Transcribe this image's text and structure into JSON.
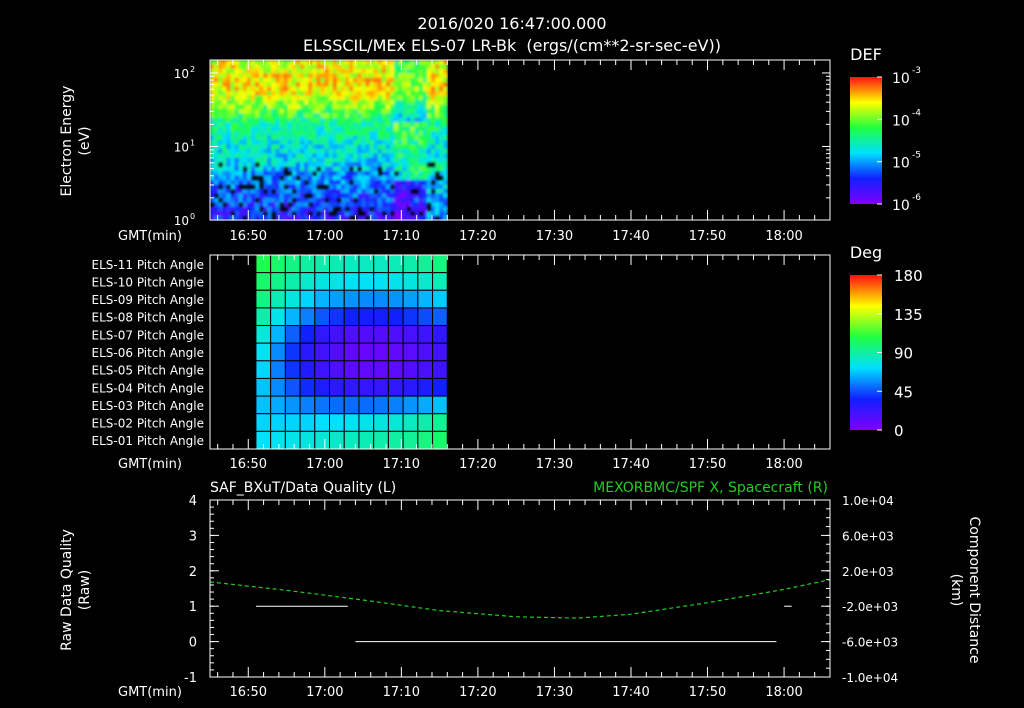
{
  "header": {
    "time": "2016/020 16:47:00.000",
    "instrument": "ELSSCIL/MEx ELS-07 LR-Bk  (ergs/(cm**2-sr-sec-eV))"
  },
  "colors": {
    "background": "#000000",
    "axes": "#ffffff",
    "text": "#ffffff",
    "series_right": "#22cc22"
  },
  "chart_data": [
    {
      "type": "heatmap",
      "name": "energy-spectrogram",
      "ylabel_line1": "Electron Energy",
      "ylabel_line2": "(eV)",
      "xlabel": "GMT(min)",
      "x_unit": "GMT time",
      "xlim": [
        "16:45",
        "18:06"
      ],
      "ylim": [
        1,
        150
      ],
      "yscale": "log",
      "y_ticks": [
        {
          "value": 1,
          "label": "10",
          "exp": "0"
        },
        {
          "value": 10,
          "label": "10",
          "exp": "1"
        },
        {
          "value": 100,
          "label": "10",
          "exp": "2"
        }
      ],
      "x_tick_labels": [
        "16:50",
        "17:00",
        "17:10",
        "17:20",
        "17:30",
        "17:40",
        "17:50",
        "18:00"
      ],
      "data_time_range": [
        "16:45",
        "17:16"
      ],
      "colorbar": {
        "title": "DEF",
        "scale": "log",
        "range": [
          1e-06,
          0.001
        ],
        "ticks": [
          {
            "value": 0.001,
            "label": "10",
            "exp": "-3"
          },
          {
            "value": 0.0001,
            "label": "10",
            "exp": "-4"
          },
          {
            "value": 1e-05,
            "label": "10",
            "exp": "-5"
          },
          {
            "value": 1e-06,
            "label": "10",
            "exp": "-6"
          }
        ]
      }
    },
    {
      "type": "heatmap",
      "name": "pitch-angle",
      "xlabel": "GMT(min)",
      "xlim": [
        "16:45",
        "18:06"
      ],
      "x_tick_labels": [
        "16:50",
        "17:00",
        "17:10",
        "17:20",
        "17:30",
        "17:40",
        "17:50",
        "18:00"
      ],
      "rows": [
        "ELS-11 Pitch Angle",
        "ELS-10 Pitch Angle",
        "ELS-09 Pitch Angle",
        "ELS-08 Pitch Angle",
        "ELS-07 Pitch Angle",
        "ELS-06 Pitch Angle",
        "ELS-05 Pitch Angle",
        "ELS-04 Pitch Angle",
        "ELS-03 Pitch Angle",
        "ELS-02 Pitch Angle",
        "ELS-01 Pitch Angle"
      ],
      "columns": [
        "16:51",
        "16:53",
        "16:55",
        "16:57",
        "16:59",
        "17:01",
        "17:03",
        "17:05",
        "17:07",
        "17:09",
        "17:11",
        "17:13",
        "17:15"
      ],
      "values": [
        [
          105,
          100,
          95,
          90,
          88,
          86,
          84,
          84,
          84,
          86,
          88,
          92,
          96
        ],
        [
          100,
          94,
          88,
          82,
          78,
          76,
          74,
          74,
          74,
          76,
          78,
          82,
          86
        ],
        [
          95,
          86,
          78,
          70,
          64,
          60,
          58,
          56,
          56,
          58,
          60,
          64,
          68
        ],
        [
          88,
          76,
          64,
          54,
          46,
          40,
          36,
          34,
          34,
          36,
          40,
          44,
          48
        ],
        [
          80,
          64,
          48,
          36,
          26,
          20,
          16,
          14,
          14,
          16,
          18,
          22,
          26
        ],
        [
          74,
          56,
          40,
          28,
          20,
          14,
          10,
          8,
          8,
          10,
          12,
          16,
          20
        ],
        [
          70,
          54,
          40,
          30,
          22,
          16,
          12,
          10,
          10,
          12,
          14,
          18,
          22
        ],
        [
          66,
          56,
          46,
          38,
          32,
          28,
          26,
          24,
          24,
          26,
          28,
          32,
          36
        ],
        [
          66,
          62,
          58,
          54,
          52,
          50,
          50,
          50,
          52,
          54,
          58,
          62,
          66
        ],
        [
          70,
          70,
          70,
          70,
          72,
          72,
          74,
          76,
          78,
          80,
          84,
          88,
          92
        ],
        [
          72,
          74,
          76,
          78,
          80,
          82,
          84,
          86,
          88,
          90,
          92,
          96,
          100
        ]
      ],
      "colorbar": {
        "title": "Deg",
        "range": [
          0,
          180
        ],
        "ticks": [
          180,
          135,
          90,
          45,
          0
        ]
      }
    },
    {
      "type": "line",
      "name": "quality-and-position",
      "title_left": "SAF_BXuT/Data Quality (L)",
      "title_right": "MEXORBMC/SPF X, Spacecraft (R)",
      "ylabel_left_line1": "Raw Data Quality",
      "ylabel_left_line2": "(Raw)",
      "ylabel_right_line1": "Component Distance",
      "ylabel_right_line2": "(km)",
      "xlabel": "GMT(min)",
      "xlim": [
        "16:45",
        "18:06"
      ],
      "x_tick_labels": [
        "16:50",
        "17:00",
        "17:10",
        "17:20",
        "17:30",
        "17:40",
        "17:50",
        "18:00"
      ],
      "ylim_left": [
        -1,
        4
      ],
      "ylim_right": [
        -10000,
        10000
      ],
      "left_ticks": [
        "4",
        "3",
        "2",
        "1",
        "0",
        "-1"
      ],
      "right_ticks": [
        {
          "value": 10000,
          "label": "1.0e+04"
        },
        {
          "value": 6000,
          "label": "6.0e+03"
        },
        {
          "value": 2000,
          "label": "2.0e+03"
        },
        {
          "value": -2000,
          "label": "-2.0e+03"
        },
        {
          "value": -6000,
          "label": "-6.0e+03"
        },
        {
          "value": -10000,
          "label": "-1.0e+04"
        }
      ],
      "series": [
        {
          "name": "SAF_BXuT/Data Quality",
          "axis": "left",
          "color": "#ffffff",
          "segments": [
            {
              "x": [
                "16:51",
                "17:03"
              ],
              "y": 1
            },
            {
              "x": [
                "17:04",
                "17:59"
              ],
              "y": 0
            },
            {
              "x": [
                "18:00",
                "18:01"
              ],
              "y": 1
            }
          ]
        },
        {
          "name": "MEXORBMC/SPF X, Spacecraft",
          "axis": "right",
          "color": "#22cc22",
          "x": [
            "16:45",
            "16:55",
            "17:05",
            "17:15",
            "17:25",
            "17:33",
            "17:40",
            "17:50",
            "18:00",
            "18:06"
          ],
          "y": [
            750,
            -200,
            -1300,
            -2500,
            -3200,
            -3350,
            -2900,
            -1600,
            -100,
            1000
          ]
        }
      ]
    }
  ]
}
